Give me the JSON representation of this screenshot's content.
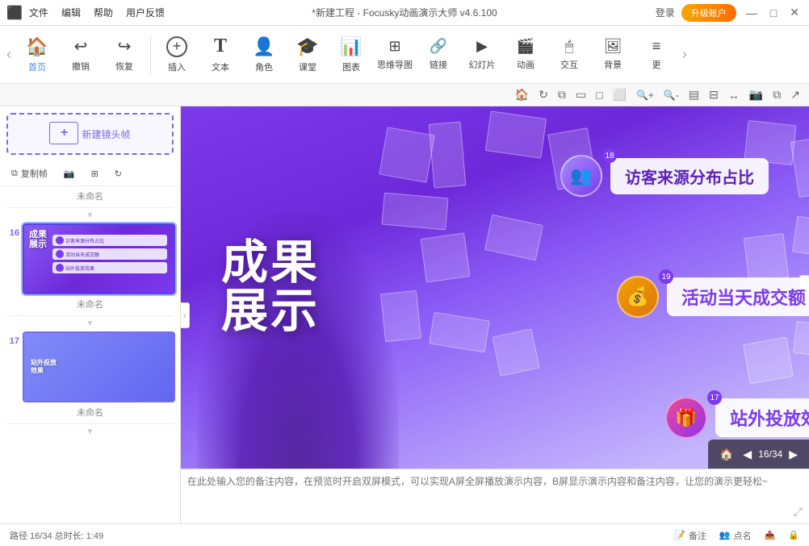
{
  "titlebar": {
    "menu_items": [
      "",
      "文件",
      "编辑",
      "帮助",
      "用户反馈"
    ],
    "title": "*新建工程 - Focusky动画演示大师  v4.6.100",
    "login_label": "登录",
    "upgrade_label": "升级账户",
    "win_btns": [
      "—",
      "□",
      "✕"
    ]
  },
  "toolbar": {
    "items": [
      {
        "id": "home",
        "icon": "🏠",
        "label": "首页"
      },
      {
        "id": "undo",
        "icon": "↩",
        "label": "撤销"
      },
      {
        "id": "redo",
        "icon": "↪",
        "label": "恢复"
      },
      {
        "id": "insert",
        "icon": "⊕",
        "label": "插入"
      },
      {
        "id": "text",
        "icon": "T",
        "label": "文本"
      },
      {
        "id": "role",
        "icon": "👤",
        "label": "角色"
      },
      {
        "id": "class",
        "icon": "🎓",
        "label": "课堂"
      },
      {
        "id": "chart",
        "icon": "📊",
        "label": "图表"
      },
      {
        "id": "mindmap",
        "icon": "🧠",
        "label": "思维导图"
      },
      {
        "id": "link",
        "icon": "🔗",
        "label": "链接"
      },
      {
        "id": "slide",
        "icon": "▶",
        "label": "幻灯片"
      },
      {
        "id": "animation",
        "icon": "🎬",
        "label": "动画"
      },
      {
        "id": "interact",
        "icon": "🖱",
        "label": "交互"
      },
      {
        "id": "bg",
        "icon": "🖼",
        "label": "背景"
      },
      {
        "id": "more",
        "icon": "≡",
        "label": "更"
      }
    ]
  },
  "secondary_toolbar": {
    "icons": [
      "🏠",
      "↻",
      "⧉",
      "⬜",
      "⬜",
      "⬜",
      "🔍+",
      "🔍-",
      "▤",
      "⬜",
      "↔",
      "📷",
      "⧉",
      "↗"
    ]
  },
  "left_panel": {
    "new_frame_label": "新建镜头帧",
    "copy_label": "复制帧",
    "unnamed_label": "未命名",
    "slides": [
      {
        "number": "16",
        "name": "未命名",
        "active": true
      },
      {
        "number": "17",
        "name": "未命名",
        "active": false
      }
    ]
  },
  "canvas": {
    "main_title_line1": "成果",
    "main_title_line2": "展示",
    "cards": [
      {
        "num": "18",
        "text": "访客来源分布占比",
        "icon": "👥"
      },
      {
        "num": "19",
        "text": "活动当天成交额",
        "icon": "💰"
      },
      {
        "num": "17",
        "text": "站外投放效果",
        "icon": "🎁"
      }
    ],
    "page_indicator": "16/34"
  },
  "notes": {
    "placeholder": "在此处输入您的备注内容，在预览时开启双屏模式，可以实现A屏全屏播放演示内容，B屏显示演示内容和备注内容，让您的演示更轻松~"
  },
  "statusbar": {
    "path": "路径 16/34  总时长: 1:49",
    "note_label": "备注",
    "name_label": "点名",
    "icons_right": [
      "📋",
      "🔒"
    ]
  }
}
